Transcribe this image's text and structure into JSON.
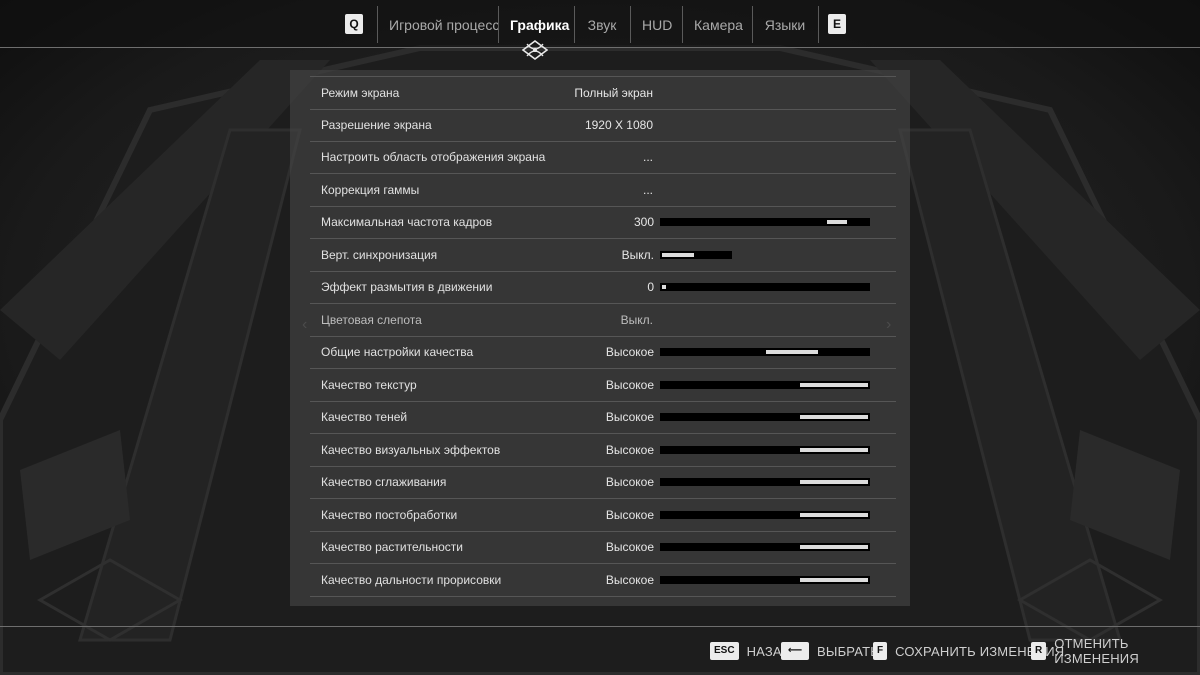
{
  "nav": {
    "left_key": "Q",
    "right_key": "E",
    "tabs": [
      {
        "label": "Игровой процесс"
      },
      {
        "label": "Графика"
      },
      {
        "label": "Звук"
      },
      {
        "label": "HUD"
      },
      {
        "label": "Камера"
      },
      {
        "label": "Языки"
      }
    ],
    "active_tab": "Графика",
    "ornament_icon": "celtic-knot-icon"
  },
  "settings": {
    "rows": [
      {
        "label": "Режим экрана",
        "value": "Полный экран",
        "slider": null
      },
      {
        "label": "Разрешение экрана",
        "value": "1920 X 1080",
        "slider": null
      },
      {
        "label": "Настроить область отображения экрана",
        "value": "...",
        "slider": null
      },
      {
        "label": "Коррекция гаммы",
        "value": "...",
        "slider": null
      },
      {
        "label": "Максимальная частота кадров",
        "value": "300",
        "slider": {
          "level": 0.9
        }
      },
      {
        "label": "Верт. синхронизация",
        "value": "Выкл.",
        "slider": {
          "level": 0.45
        }
      },
      {
        "label": "Эффект размытия в движении",
        "value": "0",
        "slider": {
          "level": 0.02
        }
      },
      {
        "label": "Цветовая слепота",
        "value": "Выкл.",
        "slider": null
      },
      {
        "label": "Общие настройки качества",
        "value": "Высокое",
        "slider": {
          "level": 0.75
        }
      },
      {
        "label": "Качество текстур",
        "value": "Высокое",
        "slider": {
          "level": 1.0
        }
      },
      {
        "label": "Качество теней",
        "value": "Высокое",
        "slider": {
          "level": 1.0
        }
      },
      {
        "label": "Качество визуальных эффектов",
        "value": "Высокое",
        "slider": {
          "level": 1.0
        }
      },
      {
        "label": "Качество сглаживания",
        "value": "Высокое",
        "slider": {
          "level": 1.0
        }
      },
      {
        "label": "Качество постобработки",
        "value": "Высокое",
        "slider": {
          "level": 1.0
        }
      },
      {
        "label": "Качество растительности",
        "value": "Высокое",
        "slider": {
          "level": 1.0
        }
      },
      {
        "label": "Качество дальности прорисовки",
        "value": "Высокое",
        "slider": {
          "level": 1.0
        }
      }
    ]
  },
  "footer": {
    "hints": [
      {
        "key": "ESC",
        "label": "НАЗАД"
      },
      {
        "key": "⟵",
        "label": "ВЫБРАТЬ"
      },
      {
        "key": "F",
        "label": "СОХРАНИТЬ ИЗМЕНЕНИЯ"
      },
      {
        "key": "R",
        "label": "ОТМЕНИТЬ ИЗМЕНЕНИЯ"
      }
    ]
  },
  "colors": {
    "background": "#151515",
    "panel": "#464646",
    "text": "#e1e1e1",
    "slider_track": "#000000",
    "slider_fill": "#dcdcdc",
    "key_badge": "#ececec"
  }
}
